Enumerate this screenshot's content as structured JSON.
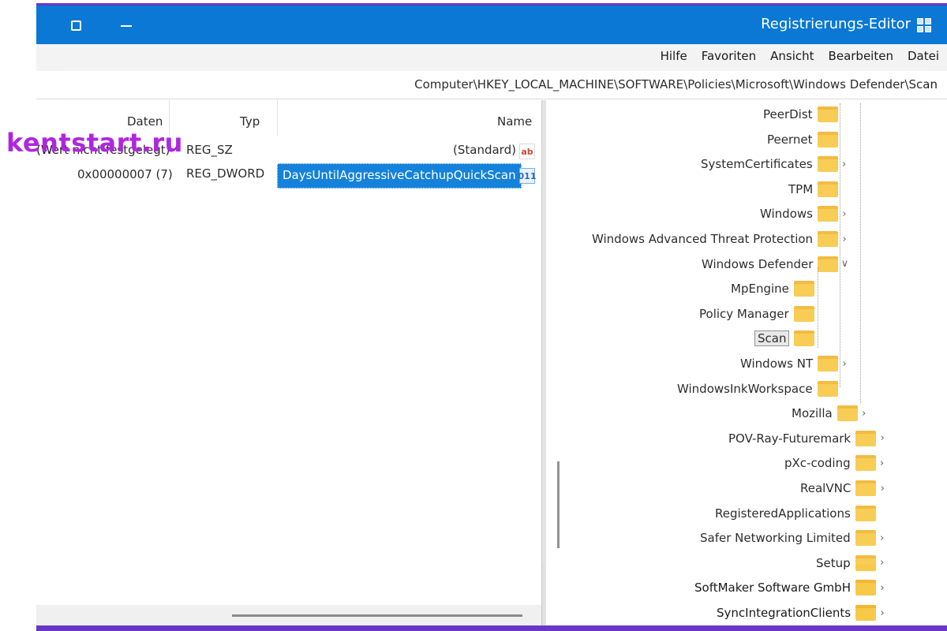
{
  "titlebar": {
    "title": "Registrierungs-Editor",
    "icons": [
      "restore-icon",
      "minimize-icon",
      "registry-app-icon"
    ]
  },
  "menubar": {
    "items": [
      "Datei",
      "Bearbeiten",
      "Ansicht",
      "Favoriten",
      "Hilfe"
    ]
  },
  "address": {
    "path": "Computer\\HKEY_LOCAL_MACHINE\\SOFTWARE\\Policies\\Microsoft\\Windows Defender\\Scan"
  },
  "values": {
    "columns": {
      "name": "Name",
      "type": "Typ",
      "data": "Daten"
    },
    "rows": [
      {
        "name": "(Standard)",
        "type": "REG_SZ",
        "data": "(Wert nicht festgelegt)",
        "icon": "string-value-icon"
      },
      {
        "name": "DaysUntilAggressiveCatchupQuickScan",
        "type": "REG_DWORD",
        "data": "0x00000007 (7)",
        "icon": "binary-value-icon",
        "selected": true
      }
    ]
  },
  "tree": {
    "items": [
      {
        "label": "PeerDist",
        "chevron": ""
      },
      {
        "label": "Peernet",
        "chevron": ""
      },
      {
        "label": "SystemCertificates",
        "chevron": ">"
      },
      {
        "label": "TPM",
        "chevron": ""
      },
      {
        "label": "Windows",
        "chevron": ">"
      },
      {
        "label": "Windows Advanced Threat Protection",
        "chevron": ">"
      },
      {
        "label": "Windows Defender",
        "chevron": "v"
      },
      {
        "label": "MpEngine",
        "chevron": ""
      },
      {
        "label": "Policy Manager",
        "chevron": ""
      },
      {
        "label": "Scan",
        "chevron": "",
        "selected": true
      },
      {
        "label": "Windows NT",
        "chevron": ">"
      },
      {
        "label": "WindowsInkWorkspace",
        "chevron": ""
      },
      {
        "label": "Mozilla",
        "chevron": ">"
      },
      {
        "label": "POV-Ray-Futuremark",
        "chevron": ">"
      },
      {
        "label": "pXc-coding",
        "chevron": ">"
      },
      {
        "label": "RealVNC",
        "chevron": ">"
      },
      {
        "label": "RegisteredApplications",
        "chevron": ""
      },
      {
        "label": "Safer Networking Limited",
        "chevron": ">"
      },
      {
        "label": "Setup",
        "chevron": ">"
      },
      {
        "label": "SoftMaker Software GmbH",
        "chevron": ">"
      },
      {
        "label": "SyncIntegrationClients",
        "chevron": ">"
      }
    ]
  },
  "branding": {
    "text": "kentstart.ru"
  },
  "colors": {
    "titlebar": "#0a78d4",
    "selection": "#0078d7",
    "folder": "#f7c948",
    "branding": "#b026e0",
    "frame_accent": "#6a35c9"
  }
}
